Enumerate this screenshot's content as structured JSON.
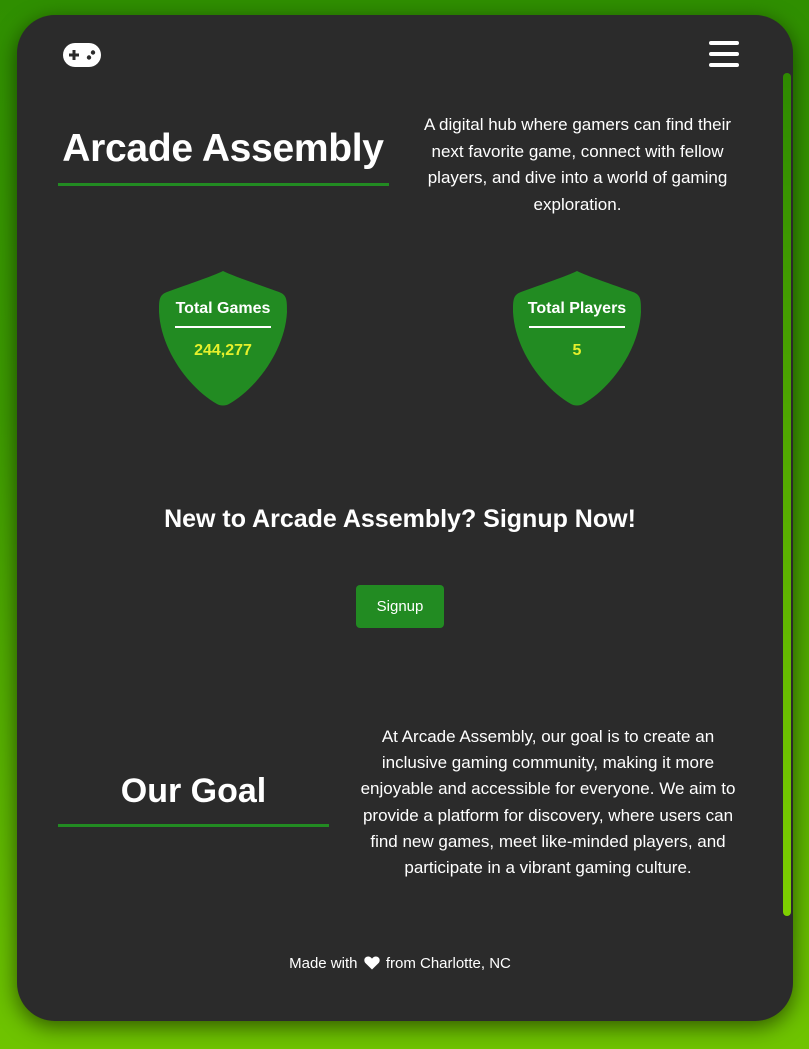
{
  "header": {
    "logo_icon": "gamepad-icon",
    "menu_icon": "hamburger-menu-icon"
  },
  "hero": {
    "title": "Arcade Assembly",
    "description": "A digital hub where gamers can find their next favorite game, connect with fellow players, and dive into a world of gaming exploration."
  },
  "stats": {
    "games": {
      "label": "Total Games",
      "value": "244,277"
    },
    "players": {
      "label": "Total Players",
      "value": "5"
    }
  },
  "cta": {
    "heading": "New to Arcade Assembly? Signup Now!",
    "button_label": "Signup"
  },
  "goal": {
    "title": "Our Goal",
    "description": "At Arcade Assembly, our goal is to create an inclusive gaming community, making it more enjoyable and accessible for everyone. We aim to provide a platform for discovery, where users can find new games, meet like-minded players, and participate in a vibrant gaming culture."
  },
  "footer": {
    "prefix": "Made with",
    "heart_icon": "heart-icon",
    "suffix": "from Charlotte, NC"
  },
  "colors": {
    "accent": "#228b22",
    "stat_value": "#e6f02c",
    "card_bg": "#2b2b2b"
  }
}
